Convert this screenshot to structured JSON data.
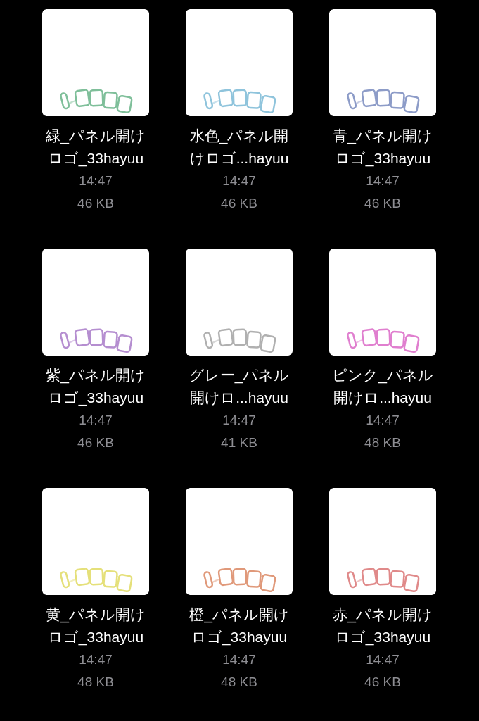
{
  "files": [
    {
      "name": [
        "緑_パネル開け",
        "ロゴ_33hayuu"
      ],
      "time": "14:47",
      "size": "46 KB",
      "color": "#7fbf9a"
    },
    {
      "name": [
        "水色_パネル開",
        "けロゴ...hayuu"
      ],
      "time": "14:47",
      "size": "46 KB",
      "color": "#8fc4dc"
    },
    {
      "name": [
        "青_パネル開け",
        "ロゴ_33hayuu"
      ],
      "time": "14:47",
      "size": "46 KB",
      "color": "#8d9cc8"
    },
    {
      "name": [
        "紫_パネル開け",
        "ロゴ_33hayuu"
      ],
      "time": "14:47",
      "size": "46 KB",
      "color": "#b58ed0"
    },
    {
      "name": [
        "グレー_パネル",
        "開けロ...hayuu"
      ],
      "time": "14:47",
      "size": "41 KB",
      "color": "#b0b0b0"
    },
    {
      "name": [
        "ピンク_パネル",
        "開けロ...hayuu"
      ],
      "time": "14:47",
      "size": "48 KB",
      "color": "#e07fcf"
    },
    {
      "name": [
        "黄_パネル開け",
        "ロゴ_33hayuu"
      ],
      "time": "14:47",
      "size": "48 KB",
      "color": "#e5e07a"
    },
    {
      "name": [
        "橙_パネル開け",
        "ロゴ_33hayuu"
      ],
      "time": "14:47",
      "size": "48 KB",
      "color": "#e0997a"
    },
    {
      "name": [
        "赤_パネル開け",
        "ロゴ_33hayuu"
      ],
      "time": "14:47",
      "size": "46 KB",
      "color": "#e08a8a"
    }
  ]
}
